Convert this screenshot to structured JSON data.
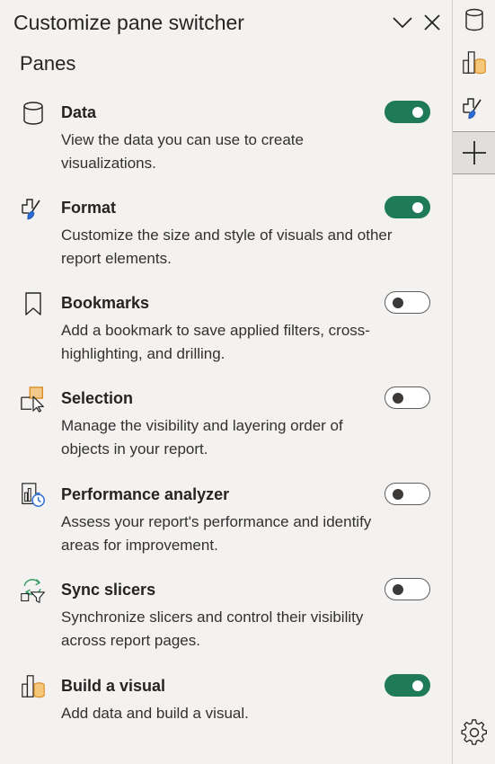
{
  "pane": {
    "title": "Customize pane switcher",
    "section_title": "Panes",
    "items": [
      {
        "name": "Data",
        "description": "View the data you can use to create visualizations.",
        "icon": "data-cylinder-icon",
        "enabled": true
      },
      {
        "name": "Format",
        "description": "Customize the size and style of visuals and other report elements.",
        "icon": "format-paintbrush-icon",
        "enabled": true
      },
      {
        "name": "Bookmarks",
        "description": "Add a bookmark to save applied filters, cross-highlighting, and drilling.",
        "icon": "bookmark-icon",
        "enabled": false
      },
      {
        "name": "Selection",
        "description": "Manage the visibility and layering order of objects in your report.",
        "icon": "selection-cursor-icon",
        "enabled": false
      },
      {
        "name": "Performance analyzer",
        "description": "Assess your report's performance and identify areas for improvement.",
        "icon": "performance-stopwatch-icon",
        "enabled": false
      },
      {
        "name": "Sync slicers",
        "description": "Synchronize slicers and control their visibility across report pages.",
        "icon": "sync-filter-icon",
        "enabled": false
      },
      {
        "name": "Build a visual",
        "description": "Add data and build a visual.",
        "icon": "build-visual-icon",
        "enabled": true
      }
    ]
  },
  "rail": {
    "buttons": [
      "data-cylinder-icon",
      "build-visual-icon",
      "format-paintbrush-icon",
      "plus-icon"
    ],
    "active": "plus-icon",
    "bottom": "gear-icon"
  },
  "colors": {
    "toggle_on": "#1f7a5a",
    "accent_orange": "#e8a33d",
    "accent_blue": "#2b6cd6",
    "accent_green": "#2f9a60"
  }
}
